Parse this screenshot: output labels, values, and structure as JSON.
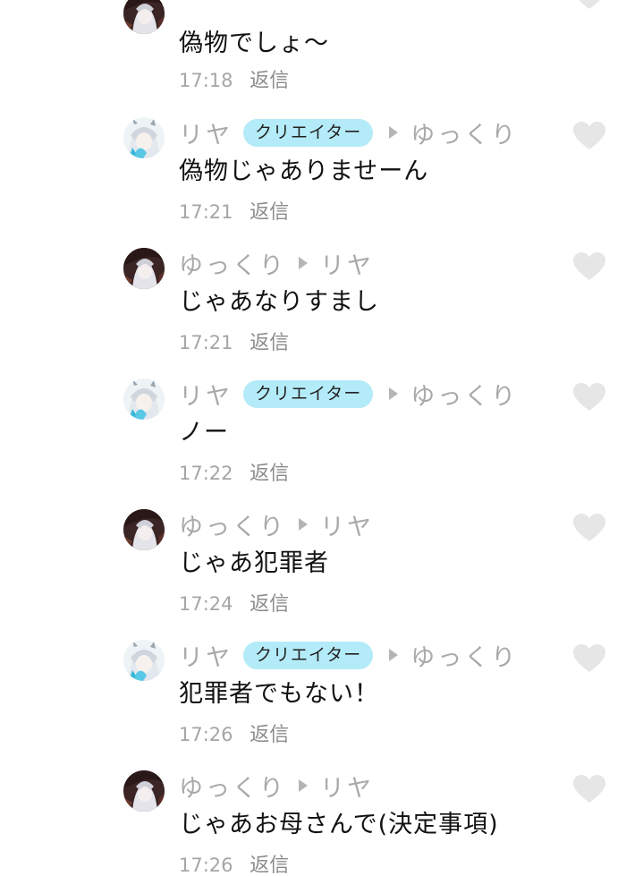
{
  "comments": [
    {
      "avatar": "avatar-yukkuri",
      "author": "",
      "badge": "",
      "reply_to": "",
      "text": "偽物でしょ〜",
      "time": "17:18",
      "reply_label": "返信",
      "liked": false
    },
    {
      "avatar": "avatar-riya",
      "author": "リヤ",
      "badge": "クリエイター",
      "reply_to": "ゆっくり",
      "text": "偽物じゃありませーん",
      "time": "17:21",
      "reply_label": "返信",
      "liked": false
    },
    {
      "avatar": "avatar-yukkuri",
      "author": "ゆっくり",
      "badge": "",
      "reply_to": "リヤ",
      "text": "じゃあなりすまし",
      "time": "17:21",
      "reply_label": "返信",
      "liked": false
    },
    {
      "avatar": "avatar-riya",
      "author": "リヤ",
      "badge": "クリエイター",
      "reply_to": "ゆっくり",
      "text": "ノー",
      "time": "17:22",
      "reply_label": "返信",
      "liked": false
    },
    {
      "avatar": "avatar-yukkuri",
      "author": "ゆっくり",
      "badge": "",
      "reply_to": "リヤ",
      "text": "じゃあ犯罪者",
      "time": "17:24",
      "reply_label": "返信",
      "liked": false
    },
    {
      "avatar": "avatar-riya",
      "author": "リヤ",
      "badge": "クリエイター",
      "reply_to": "ゆっくり",
      "text": "犯罪者でもない！",
      "time": "17:26",
      "reply_label": "返信",
      "liked": false
    },
    {
      "avatar": "avatar-yukkuri",
      "author": "ゆっくり",
      "badge": "",
      "reply_to": "リヤ",
      "text": "じゃあお母さんで(決定事項)",
      "time": "17:26",
      "reply_label": "返信",
      "liked": false
    }
  ],
  "colors": {
    "badge_bg": "#b4ebf8",
    "muted_text": "#a9a9a9",
    "body_text": "#111111",
    "like_icon": "#e6e6e6"
  },
  "icons": {
    "reply_indicator": "reply-arrow-icon",
    "like": "heart-icon"
  }
}
